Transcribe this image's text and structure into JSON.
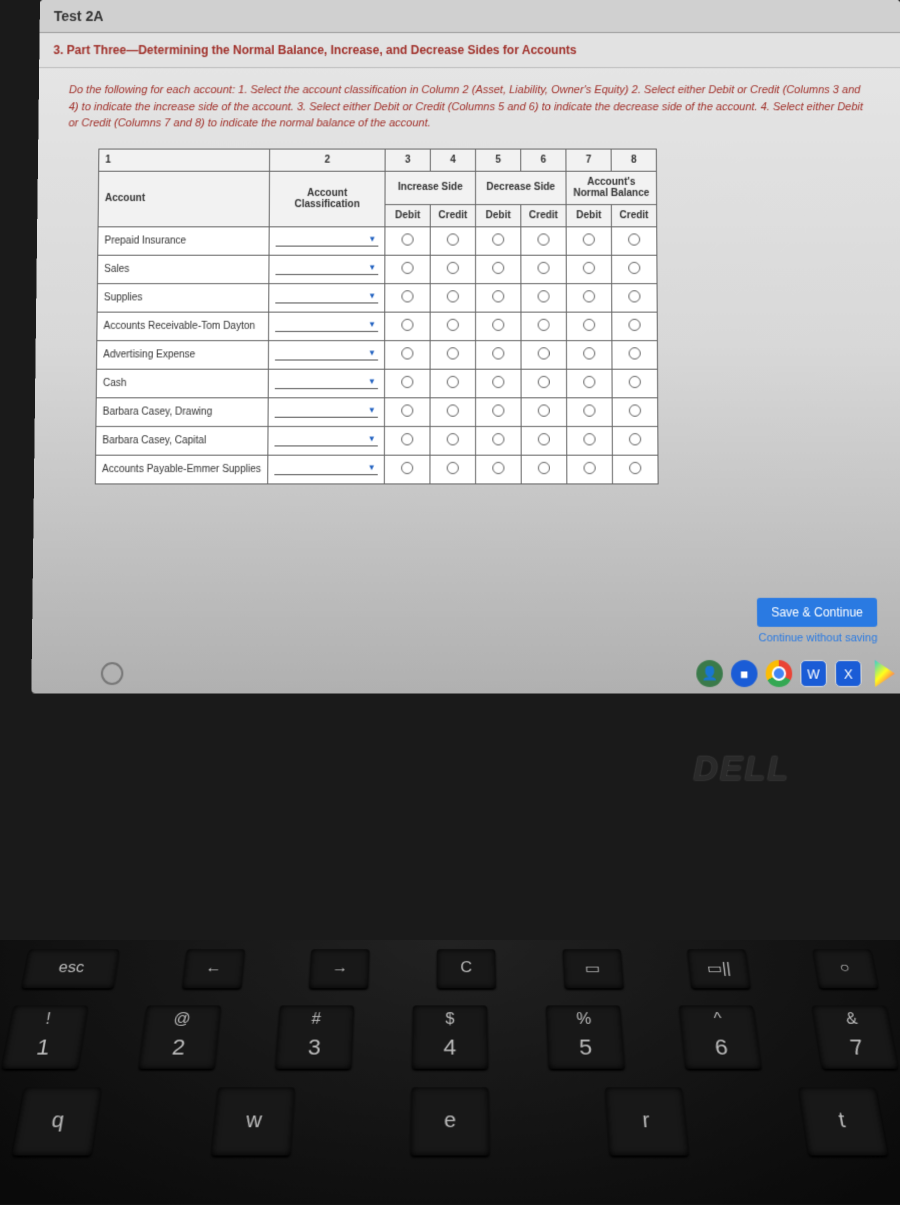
{
  "header": {
    "test_label": "Test 2A"
  },
  "section": {
    "title": "3. Part Three—Determining the Normal Balance, Increase, and Decrease Sides for Accounts"
  },
  "instructions": "Do the following for each account: 1. Select the account classification in Column 2 (Asset, Liability, Owner's Equity) 2. Select either Debit or Credit (Columns 3 and 4) to indicate the increase side of the account. 3. Select either Debit or Credit (Columns 5 and 6) to indicate the decrease side of the account. 4. Select either Debit or Credit (Columns 7 and 8) to indicate the normal balance of the account.",
  "columns": {
    "c1": "1",
    "c2": "2",
    "c3": "3",
    "c4": "4",
    "c5": "5",
    "c6": "6",
    "c7": "7",
    "c8": "8",
    "account": "Account",
    "classification": "Account Classification",
    "increase_side": "Increase Side",
    "decrease_side": "Decrease Side",
    "normal_balance": "Account's Normal Balance",
    "debit": "Debit",
    "credit": "Credit"
  },
  "accounts": [
    "Prepaid Insurance",
    "Sales",
    "Supplies",
    "Accounts Receivable-Tom Dayton",
    "Advertising Expense",
    "Cash",
    "Barbara Casey, Drawing",
    "Barbara Casey, Capital",
    "Accounts Payable-Emmer Supplies"
  ],
  "actions": {
    "save": "Save & Continue",
    "continue": "Continue without saving"
  },
  "brand": "DELL",
  "keys": {
    "esc": "esc",
    "row_fn": [
      "←",
      "→",
      "C",
      "▭",
      "▭||",
      "○"
    ],
    "row_num": [
      {
        "u": "!",
        "l": "1"
      },
      {
        "u": "@",
        "l": "2"
      },
      {
        "u": "#",
        "l": "3"
      },
      {
        "u": "$",
        "l": "4"
      },
      {
        "u": "%",
        "l": "5"
      },
      {
        "u": "^",
        "l": "6"
      },
      {
        "u": "&",
        "l": "7"
      }
    ],
    "row_qw": [
      "q",
      "w",
      "e",
      "r",
      "t"
    ]
  }
}
